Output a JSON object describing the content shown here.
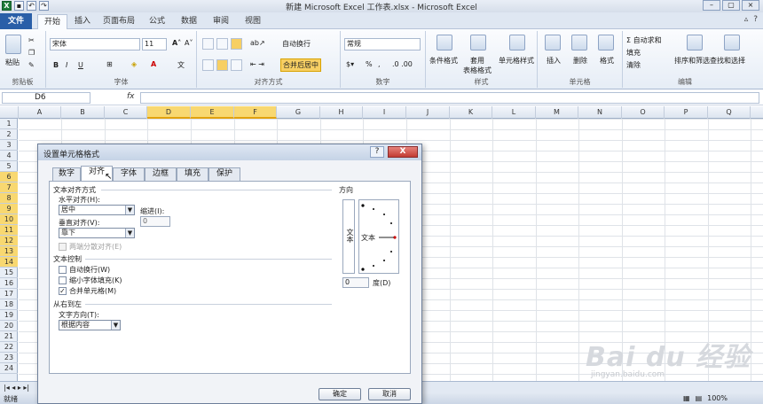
{
  "window": {
    "title": "新建 Microsoft Excel 工作表.xlsx - Microsoft Excel"
  },
  "tabs": [
    "文件",
    "开始",
    "插入",
    "页面布局",
    "公式",
    "数据",
    "审阅",
    "视图"
  ],
  "ribbon": {
    "groups": {
      "clipboard": "剪贴板",
      "font": "字体",
      "alignment": "对齐方式",
      "number": "数字",
      "styles": "样式",
      "cells": "单元格",
      "editing": "编辑"
    },
    "paste": "粘贴",
    "font_name": "宋体",
    "font_size": "11",
    "wrap_text": "自动换行",
    "merge_center": "合并后居中",
    "number_format": "常规",
    "cond_format": "条件格式",
    "table_format": "套用\n表格格式",
    "cell_style": "单元格样式",
    "insert": "插入",
    "delete": "删除",
    "format": "格式",
    "autosum": "Σ 自动求和",
    "fill": "填充",
    "clear": "清除",
    "sort_filter": "排序和筛选",
    "find_select": "查找和选择"
  },
  "formula_bar": {
    "name_box": "D6",
    "fx": "fx"
  },
  "columns": [
    "A",
    "B",
    "C",
    "D",
    "E",
    "F",
    "G",
    "H",
    "I",
    "J",
    "K",
    "L",
    "M",
    "N",
    "O",
    "P",
    "Q"
  ],
  "rows": [
    "1",
    "2",
    "3",
    "4",
    "5",
    "6",
    "7",
    "8",
    "9",
    "10",
    "11",
    "12",
    "13",
    "14",
    "15",
    "16",
    "17",
    "18",
    "19",
    "20",
    "21",
    "22",
    "23",
    "24"
  ],
  "dialog": {
    "title": "设置单元格格式",
    "help": "?",
    "close": "X",
    "tabs": [
      "数字",
      "对齐",
      "字体",
      "边框",
      "填充",
      "保护"
    ],
    "text_alignment": "文本对齐方式",
    "horizontal_label": "水平对齐(H):",
    "horizontal_value": "居中",
    "indent_label": "缩进(I):",
    "indent_value": "0",
    "vertical_label": "垂直对齐(V):",
    "vertical_value": "靠下",
    "justify_distributed": "两端分散对齐(E)",
    "text_control": "文本控制",
    "wrap_text": "自动换行(W)",
    "shrink_to_fit": "缩小字体填充(K)",
    "merge_cells": "合并单元格(M)",
    "rtl": "从右到左",
    "text_direction_label": "文字方向(T):",
    "text_direction_value": "根据内容",
    "orientation": "方向",
    "orient_text_vertical": "文本",
    "orient_text": "文本",
    "degrees_value": "0",
    "degrees_label": "度(D)",
    "ok": "确定",
    "cancel": "取消"
  },
  "status": {
    "ready": "就绪",
    "zoom": "100%"
  },
  "watermark": {
    "main": "Bai du 经验",
    "sub": "jingyan.baidu.com"
  }
}
